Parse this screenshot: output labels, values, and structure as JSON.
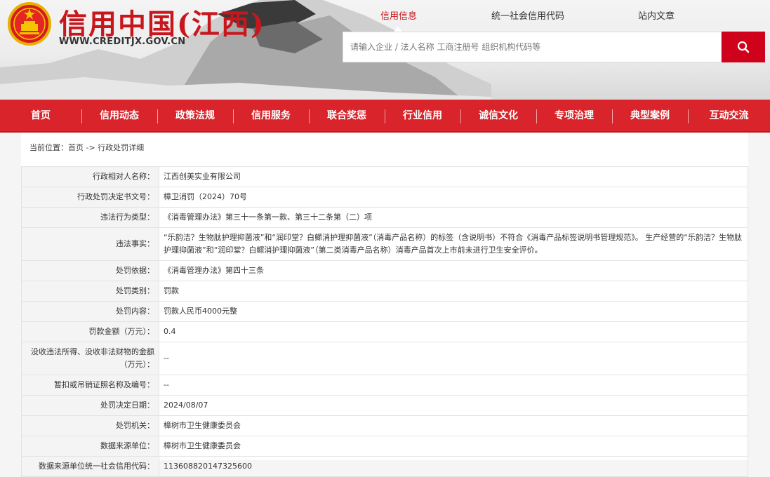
{
  "header": {
    "site_title": "信用中国(江西)",
    "site_url": "WWW.CREDITJX.GOV.CN",
    "search_tabs": [
      "信用信息",
      "统一社会信用代码",
      "站内文章"
    ],
    "active_tab": "信用信息",
    "search_placeholder": "请输入企业 / 法人名称 工商注册号 组织机构代码等",
    "search_icon": "search-icon",
    "brand_red": "#c8161d"
  },
  "nav": {
    "items": [
      "首页",
      "信用动态",
      "政策法规",
      "信用服务",
      "联合奖惩",
      "行业信用",
      "诚信文化",
      "专项治理",
      "典型案例",
      "互动交流"
    ],
    "bg_color": "#d8242a"
  },
  "breadcrumb": {
    "prefix": "当前位置：",
    "home": "首页",
    "separator": " -> ",
    "current": "行政处罚详细"
  },
  "details": {
    "rows": [
      {
        "label": "行政相对人名称：",
        "value": "江西创美实业有限公司"
      },
      {
        "label": "行政处罚决定书文号：",
        "value": "樟卫消罚（2024）70号"
      },
      {
        "label": "违法行为类型：",
        "value": "《消毒管理办法》第三十一条第一款、第三十二条第（二）项"
      },
      {
        "label": "违法事实：",
        "value": "“乐韵洁？生物肽护理抑菌液”和“润印堂？白鳏消护理抑菌液”（消毒产品名称）的标签（含说明书）不符合《消毒产品标签说明书管理规范》。 生产经营的“乐韵洁？生物肽护理抑菌液”和“润印堂？白鳏消护理抑菌液”（第二类消毒产品名称）消毒产品首次上市前未进行卫生安全评价。"
      },
      {
        "label": "处罚依据：",
        "value": "《消毒管理办法》第四十三条"
      },
      {
        "label": "处罚类别：",
        "value": "罚款"
      },
      {
        "label": "处罚内容：",
        "value": "罚款人民币4000元整"
      },
      {
        "label": "罚款金额（万元）：",
        "value": "0.4"
      },
      {
        "label": "没收违法所得、没收非法财物的金额（万元）：",
        "value": "--"
      },
      {
        "label": "暂扣或吊销证照名称及编号：",
        "value": "--"
      },
      {
        "label": "处罚决定日期：",
        "value": "2024/08/07"
      },
      {
        "label": "处罚机关：",
        "value": "樟树市卫生健康委员会"
      },
      {
        "label": "数据来源单位：",
        "value": "樟树市卫生健康委员会"
      },
      {
        "label": "数据来源单位统一社会信用代码：",
        "value": "113608820147325600"
      }
    ]
  }
}
